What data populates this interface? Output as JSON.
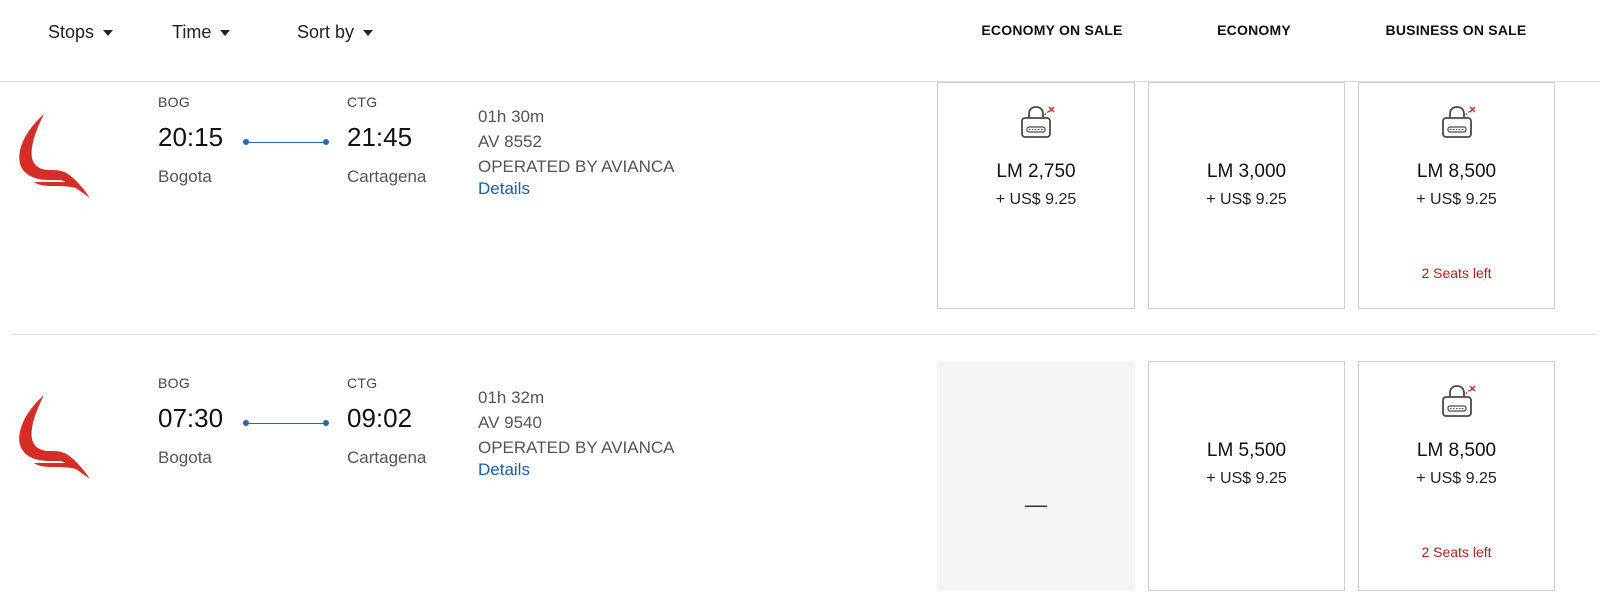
{
  "filters": {
    "stops_label": "Stops",
    "time_label": "Time",
    "sort_label": "Sort by"
  },
  "columns": [
    "ECONOMY ON SALE",
    "ECONOMY",
    "BUSINESS ON SALE"
  ],
  "colors": {
    "accent": "#2a67b1",
    "link": "#1d5fa8",
    "alert": "#b3211e",
    "logo": "#d42e27"
  },
  "icons": {
    "airline_logo": "avianca-logo",
    "locked_fare": "lock-icon"
  },
  "flights": [
    {
      "origin_code": "BOG",
      "depart_time": "20:15",
      "origin_city": "Bogota",
      "dest_code": "CTG",
      "arrive_time": "21:45",
      "dest_city": "Cartagena",
      "duration": "01h 30m",
      "flight_number": "AV 8552",
      "operated_by": "OPERATED BY AVIANCA",
      "details_label": "Details",
      "fares": [
        {
          "miles": "LM 2,750",
          "taxes": "+ US$ 9.25",
          "locked": true,
          "seats": ""
        },
        {
          "miles": "LM 3,000",
          "taxes": "+ US$ 9.25",
          "locked": false,
          "seats": ""
        },
        {
          "miles": "LM 8,500",
          "taxes": "+ US$ 9.25",
          "locked": true,
          "seats": "2 Seats left"
        }
      ]
    },
    {
      "origin_code": "BOG",
      "depart_time": "07:30",
      "origin_city": "Bogota",
      "dest_code": "CTG",
      "arrive_time": "09:02",
      "dest_city": "Cartagena",
      "duration": "01h 32m",
      "flight_number": "AV 9540",
      "operated_by": "OPERATED BY AVIANCA",
      "details_label": "Details",
      "fares": [
        {
          "unavailable": true,
          "dash": "—"
        },
        {
          "miles": "LM 5,500",
          "taxes": "+ US$ 9.25",
          "locked": false,
          "seats": ""
        },
        {
          "miles": "LM 8,500",
          "taxes": "+ US$ 9.25",
          "locked": true,
          "seats": "2 Seats left"
        }
      ]
    }
  ]
}
